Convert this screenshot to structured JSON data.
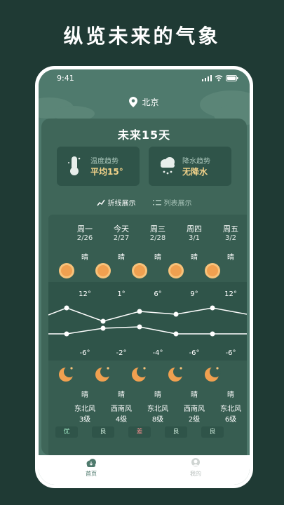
{
  "headline": "纵览未来的气象",
  "status": {
    "time": "9:41"
  },
  "location": {
    "city": "北京"
  },
  "forecast": {
    "title": "未来15天",
    "temp_trend": {
      "label": "温度趋势",
      "value": "平均15°"
    },
    "rain_trend": {
      "label": "降水趋势",
      "value": "无降水"
    },
    "views": [
      {
        "label": "折线展示",
        "active": true
      },
      {
        "label": "列表展示",
        "active": false
      }
    ],
    "days": [
      {
        "day": "周一",
        "date": "2/26",
        "weather": "晴",
        "high": "12°",
        "low": "-6°",
        "night": "晴",
        "wind_dir": "东北风",
        "wind_level": "3级",
        "aqi": "优"
      },
      {
        "day": "今天",
        "date": "2/27",
        "weather": "晴",
        "high": "1°",
        "low": "-2°",
        "night": "晴",
        "wind_dir": "西南风",
        "wind_level": "4级",
        "aqi": "良"
      },
      {
        "day": "周三",
        "date": "2/28",
        "weather": "晴",
        "high": "6°",
        "low": "-4°",
        "night": "晴",
        "wind_dir": "东北风",
        "wind_level": "8级",
        "aqi": "差"
      },
      {
        "day": "周四",
        "date": "3/1",
        "weather": "晴",
        "high": "9°",
        "low": "-6°",
        "night": "晴",
        "wind_dir": "西南风",
        "wind_level": "2级",
        "aqi": "良"
      },
      {
        "day": "周五",
        "date": "3/2",
        "weather": "晴",
        "high": "12°",
        "low": "-6°",
        "night": "晴",
        "wind_dir": "东北风",
        "wind_level": "6级",
        "aqi": "良"
      }
    ]
  },
  "tabbar": {
    "home": "首页",
    "mine": "我的"
  },
  "colors": {
    "bg": "#1f3a34",
    "screen": "#4f7a6d",
    "card": "#3f6659",
    "accent": "#f3d38a",
    "sun": "#f0a050"
  }
}
